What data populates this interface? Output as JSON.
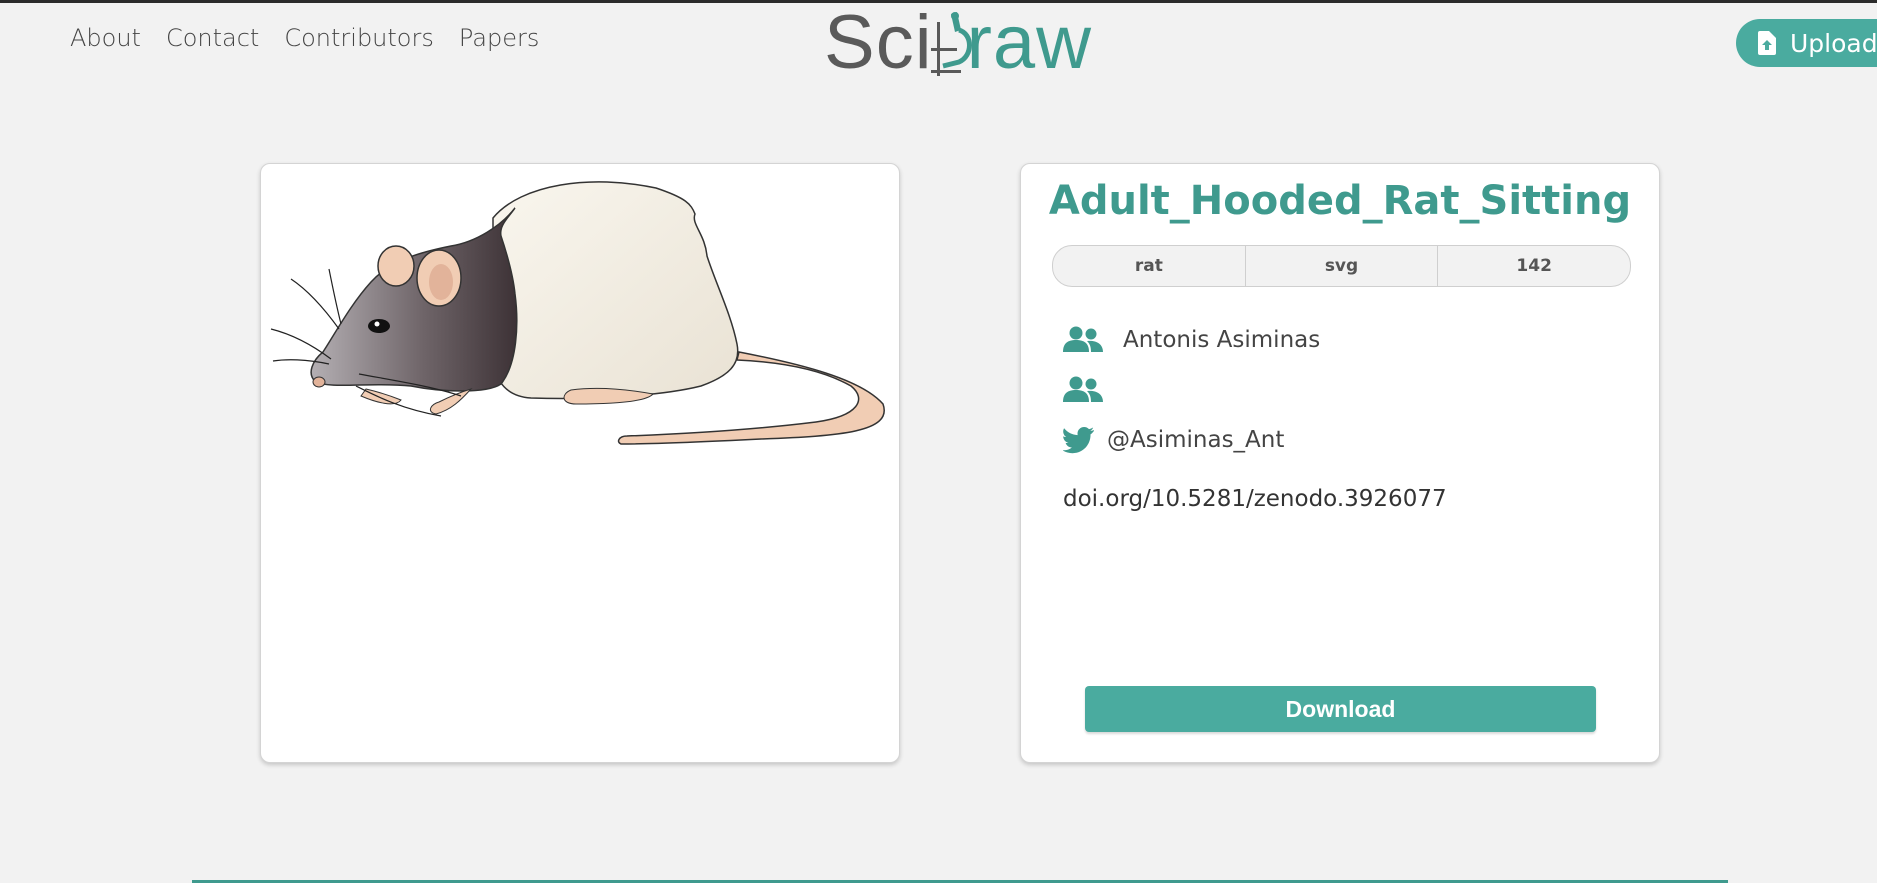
{
  "nav": {
    "items": [
      {
        "label": "About"
      },
      {
        "label": "Contact"
      },
      {
        "label": "Contributors"
      },
      {
        "label": "Papers"
      }
    ]
  },
  "logo": {
    "part1": "Sci",
    "part2": "raw"
  },
  "upload": {
    "label": "Upload",
    "icon": "file-upload-icon"
  },
  "drawing": {
    "title": "Adult_Hooded_Rat_Sitting",
    "tags": [
      {
        "label": "rat"
      },
      {
        "label": "svg"
      },
      {
        "label": "142"
      }
    ],
    "author": "Antonis Asiminas",
    "coauthors": "",
    "twitter": "@Asiminas_Ant",
    "doi": "doi.org/10.5281/zenodo.3926077"
  },
  "download": {
    "label": "Download"
  },
  "colors": {
    "accent": "#4aab9f",
    "accent_dark": "#3f9a8e",
    "logo_gray": "#5a5a5a",
    "background": "#f2f2f2"
  }
}
